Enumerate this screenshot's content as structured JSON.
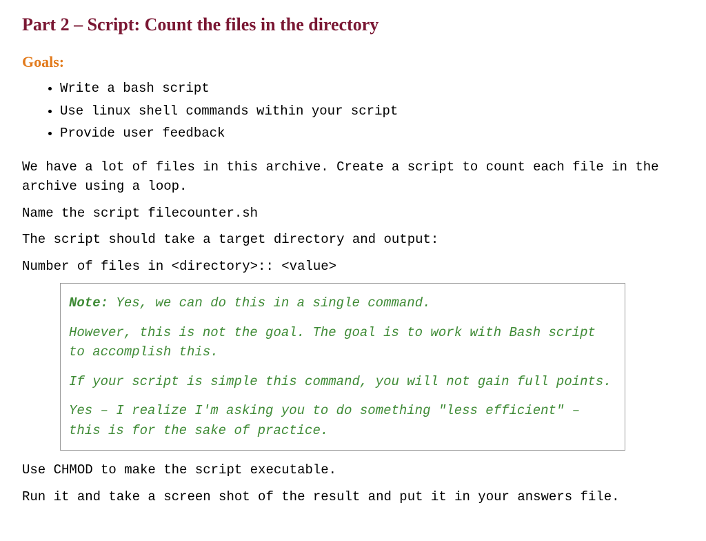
{
  "title": "Part 2 – Script: Count the files in the directory",
  "goals_heading": "Goals:",
  "goals": [
    "Write a bash script",
    "Use linux shell commands within your script",
    "Provide user feedback"
  ],
  "intro": "We have a lot of files in this archive.  Create a script to count each file in the archive using a loop.",
  "name_line": "Name the script filecounter.sh",
  "script_spec": "The script should take a target directory and output:",
  "output_spec": "Number of files in <directory>:: <value>",
  "note": {
    "label": "Note:",
    "p1_rest": " Yes, we can do this in a single command.",
    "p2": "However, this is not the goal.  The goal is to work with Bash script to accomplish this.",
    "p3": "If your script is simple this command, you will not gain full points.",
    "p4": "Yes – I realize I'm asking you to do something \"less efficient\" – this is for the sake of practice."
  },
  "chmod_line": "Use CHMOD to make the script executable.",
  "run_line": "Run it and take a screen shot of the result and put it in your answers file."
}
